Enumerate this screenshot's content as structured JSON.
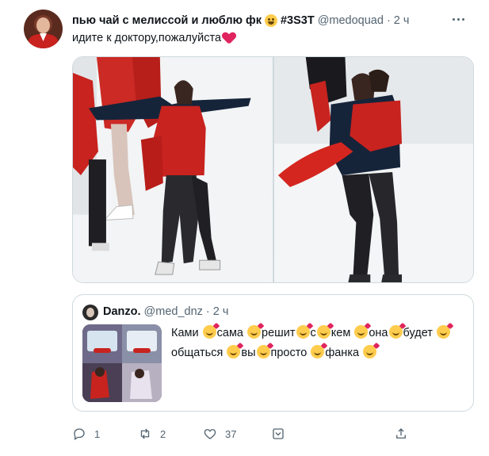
{
  "tweet": {
    "display_name": "пью чай с мелиссой и люблю фк",
    "hashtag": "#3S3T",
    "handle": "@medoquad",
    "separator": "·",
    "time": "2 ч",
    "text": "идите к доктору,пожалуйста"
  },
  "quoted": {
    "display_name": "Danzo.",
    "handle": "@med_dnz",
    "separator": "·",
    "time": "2 ч",
    "words": [
      "Ками",
      "сама",
      "решит",
      "с",
      "кем",
      "она",
      "будет",
      "общаться",
      "вы",
      "просто",
      "фанка"
    ]
  },
  "actions": {
    "reply_count": "1",
    "retweet_count": "2",
    "like_count": "37"
  },
  "colors": {
    "accent_red": "#c8231f",
    "text_primary": "#0f1419",
    "text_secondary": "#536471",
    "border": "#cfd9de"
  }
}
